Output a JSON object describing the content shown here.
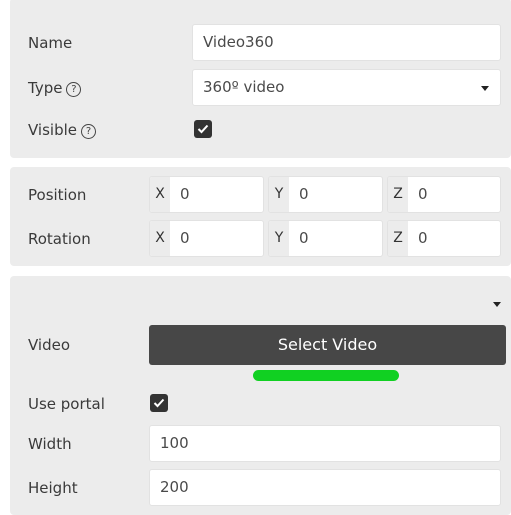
{
  "general": {
    "name_label": "Name",
    "name_value": "Video360",
    "type_label": "Type",
    "type_value": "360º video",
    "visible_label": "Visible",
    "help_glyph": "?",
    "visible_checked": true
  },
  "transform": {
    "position_label": "Position",
    "rotation_label": "Rotation",
    "axis_x": "X",
    "axis_y": "Y",
    "axis_z": "Z",
    "position": {
      "x": "0",
      "y": "0",
      "z": "0"
    },
    "rotation": {
      "x": "0",
      "y": "0",
      "z": "0"
    }
  },
  "video": {
    "video_label": "Video",
    "select_button": "Select Video",
    "upload_progress": 1.0,
    "progress_color": "#11d022",
    "use_portal_label": "Use portal",
    "use_portal_checked": true,
    "width_label": "Width",
    "width_value": "100",
    "height_label": "Height",
    "height_value": "200"
  },
  "icons": {
    "help": "help-circle-icon",
    "checkbox": "checkmark-icon",
    "dropdown": "caret-down-icon"
  }
}
